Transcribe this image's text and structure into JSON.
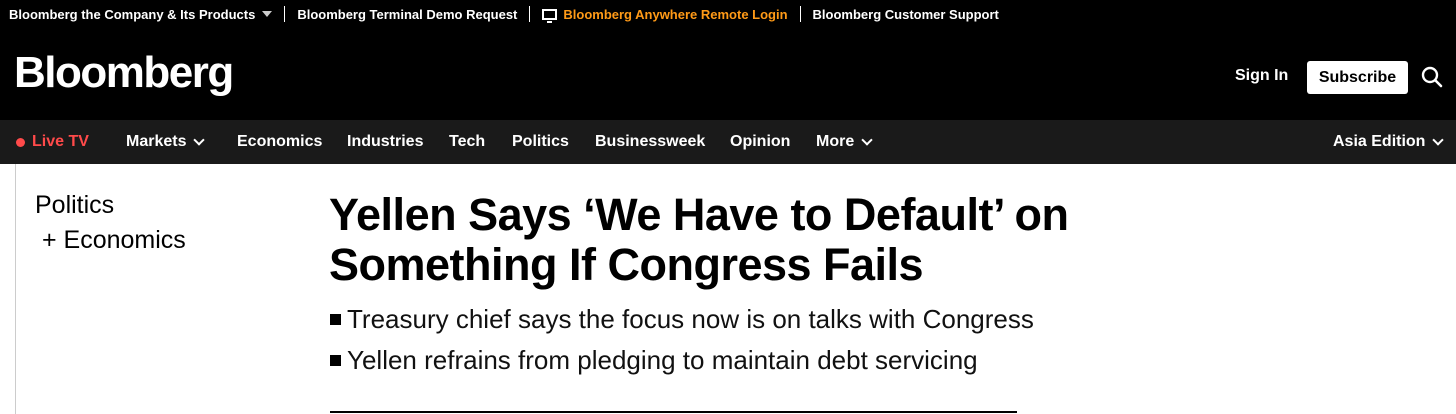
{
  "utility": {
    "items": [
      "Bloomberg the Company & Its Products",
      "Bloomberg Terminal Demo Request",
      "Bloomberg Anywhere Remote Login",
      "Bloomberg Customer Support"
    ],
    "accent": "#ff9a17"
  },
  "masthead": {
    "logo": "Bloomberg",
    "sign_in": "Sign In",
    "subscribe": "Subscribe",
    "search_icon": "search-icon"
  },
  "nav": {
    "live_tv": "Live TV",
    "items": [
      "Markets",
      "Economics",
      "Industries",
      "Tech",
      "Politics",
      "Businessweek",
      "Opinion",
      "More"
    ],
    "edition": "Asia Edition",
    "live_color": "#ff4a4a"
  },
  "article": {
    "topic_primary": "Politics",
    "topic_secondary": "+ Economics",
    "headline": "Yellen Says ‘We Have to Default’ on Something If Congress Fails",
    "bullets": [
      "Treasury chief says the focus now is on talks with Congress",
      "Yellen refrains from pledging to maintain debt servicing"
    ]
  }
}
